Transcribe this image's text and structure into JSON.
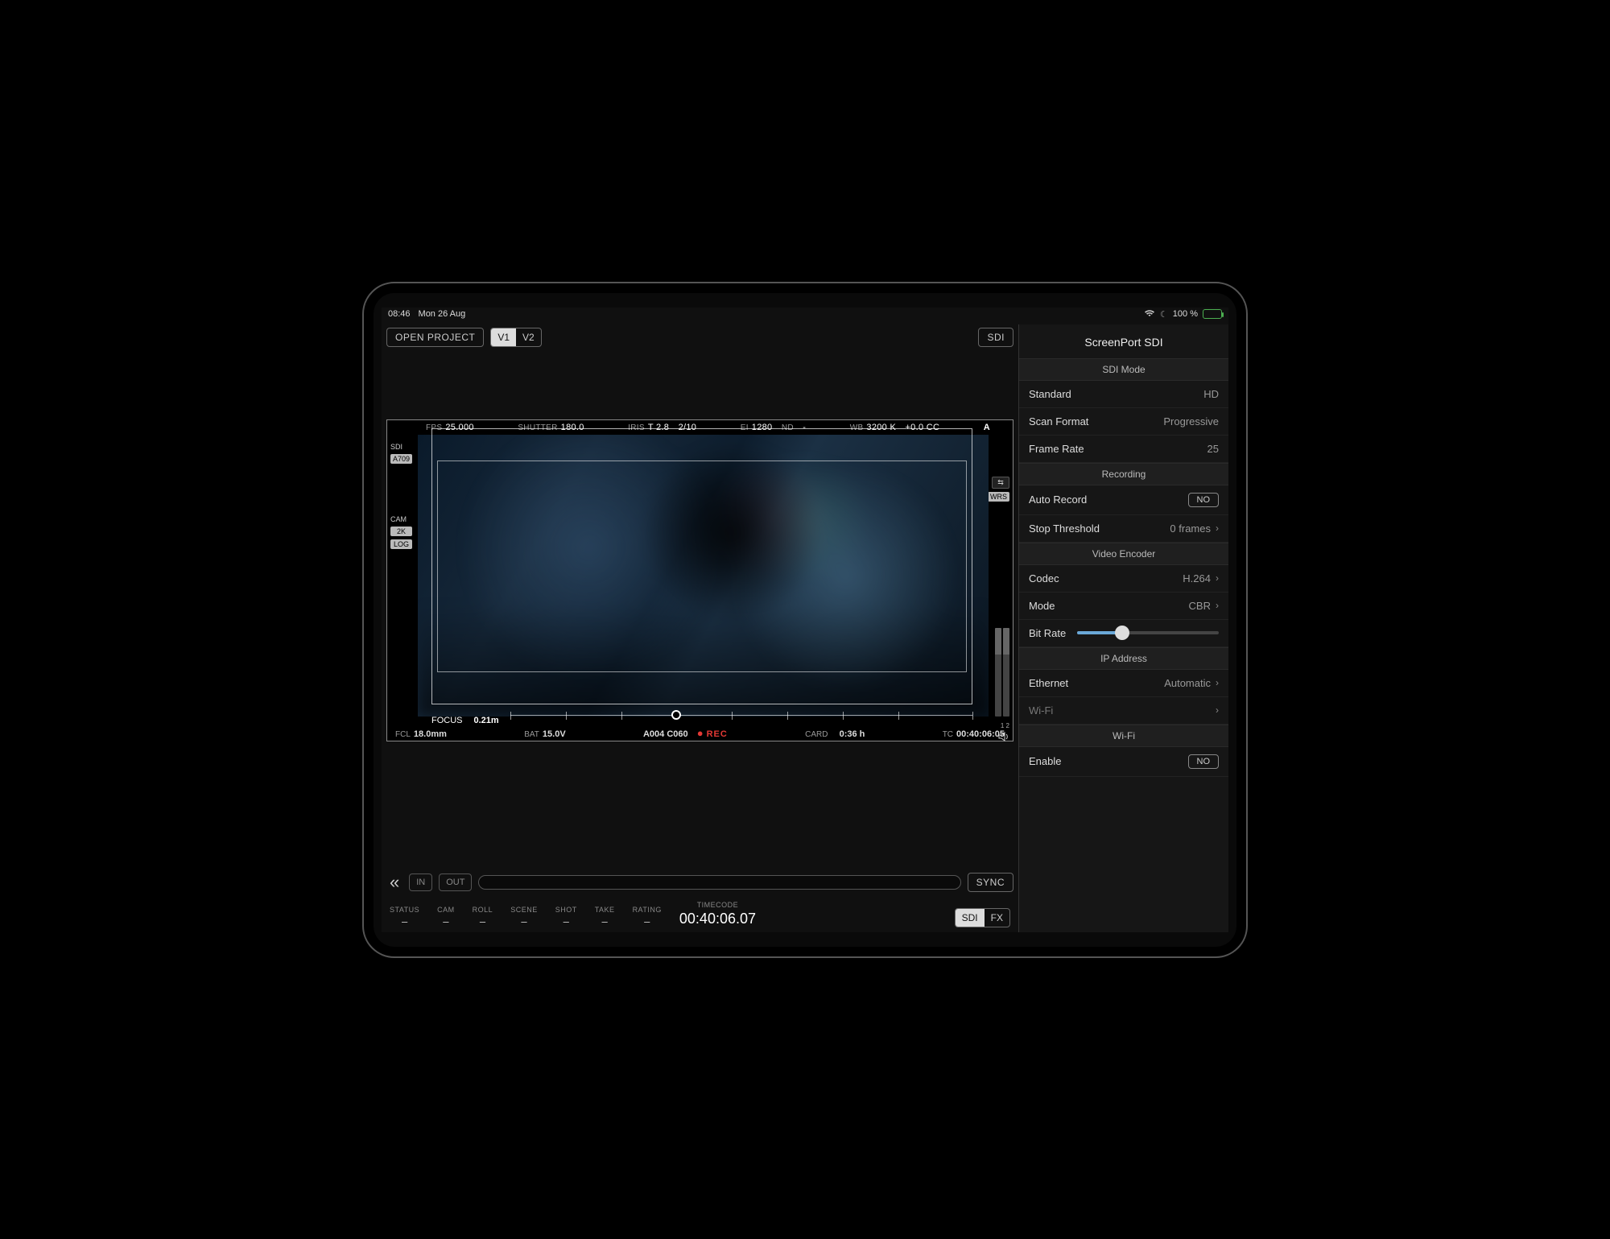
{
  "statusbar": {
    "time": "08:46",
    "date": "Mon 26 Aug",
    "battery_pct": "100 %"
  },
  "toolbar": {
    "open_project": "OPEN PROJECT",
    "v1": "V1",
    "v2": "V2",
    "sdi": "SDI"
  },
  "overlay": {
    "fps_label": "FPS",
    "fps": "25.000",
    "shutter_label": "SHUTTER",
    "shutter": "180.0",
    "iris_label": "IRIS",
    "iris": "T 2.8",
    "iris_step": "2/10",
    "ei_label": "EI",
    "ei": "1280",
    "nd_label": "ND",
    "nd": "-",
    "wb_label": "WB",
    "wb": "3200 K",
    "cc": "+0.0 CC",
    "slot": "A",
    "left_badges": {
      "sdi": "SDI",
      "a709": "A709",
      "cam": "CAM",
      "res": "2K",
      "log": "LOG"
    },
    "right_badges": {
      "sync": "⇆",
      "wrs": "WRS"
    },
    "focus_label": "FOCUS",
    "focus": "0.21m",
    "fcl_label": "FCL",
    "fcl": "18.0mm",
    "bat_label": "BAT",
    "bat": "15.0V",
    "clip": "A004 C060",
    "rec": "REC",
    "card_label": "CARD",
    "card": "0:36 h",
    "tc_label": "TC",
    "tc": "00:40:06:05",
    "audio_ch": "1 2"
  },
  "footer": {
    "in": "IN",
    "out": "OUT",
    "sync": "SYNC",
    "cols": {
      "status": "STATUS",
      "cam": "CAM",
      "roll": "ROLL",
      "scene": "SCENE",
      "shot": "SHOT",
      "take": "TAKE",
      "rating": "RATING",
      "timecode": "TIMECODE"
    },
    "dash": "–",
    "timecode": "00:40:06.07",
    "sdi": "SDI",
    "fx": "FX"
  },
  "side": {
    "title": "ScreenPort SDI",
    "sections": {
      "sdi_mode": "SDI Mode",
      "recording": "Recording",
      "video_encoder": "Video Encoder",
      "ip_address": "IP Address",
      "wifi": "Wi-Fi"
    },
    "rows": {
      "standard_k": "Standard",
      "standard_v": "HD",
      "scan_k": "Scan Format",
      "scan_v": "Progressive",
      "framerate_k": "Frame Rate",
      "framerate_v": "25",
      "autorec_k": "Auto Record",
      "autorec_v": "NO",
      "stopthr_k": "Stop Threshold",
      "stopthr_v": "0 frames",
      "codec_k": "Codec",
      "codec_v": "H.264",
      "mode_k": "Mode",
      "mode_v": "CBR",
      "bitrate_k": "Bit Rate",
      "ethernet_k": "Ethernet",
      "ethernet_v": "Automatic",
      "wifi_k": "Wi-Fi",
      "wifi_v": "",
      "enable_k": "Enable",
      "enable_v": "NO"
    },
    "bitrate_position_pct": 32
  }
}
